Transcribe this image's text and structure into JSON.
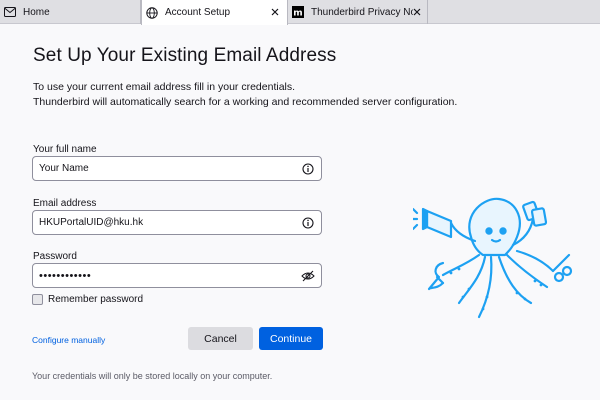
{
  "tabs": [
    {
      "label": "Home",
      "icon": "mail-icon"
    },
    {
      "label": "Account Setup",
      "icon": "globe-icon"
    },
    {
      "label": "Thunderbird Privacy Notice",
      "icon": "mozilla-icon"
    }
  ],
  "page": {
    "title": "Set Up Your Existing Email Address",
    "intro_line1": "To use your current email address fill in your credentials.",
    "intro_line2": "Thunderbird will automatically search for a working and recommended server configuration."
  },
  "form": {
    "name_label": "Your full name",
    "name_placeholder": "Your Name",
    "email_label": "Email address",
    "email_value": "HKUPortalUID@hku.hk",
    "password_label": "Password",
    "password_value": "••••••••••••",
    "remember_label": "Remember password",
    "remember_checked": false
  },
  "actions": {
    "configure_manually": "Configure manually",
    "cancel": "Cancel",
    "continue": "Continue"
  },
  "footer": {
    "note": "Your credentials will only be stored locally on your computer."
  },
  "colors": {
    "accent": "#0061e0",
    "mascot": "#1da1f2"
  }
}
